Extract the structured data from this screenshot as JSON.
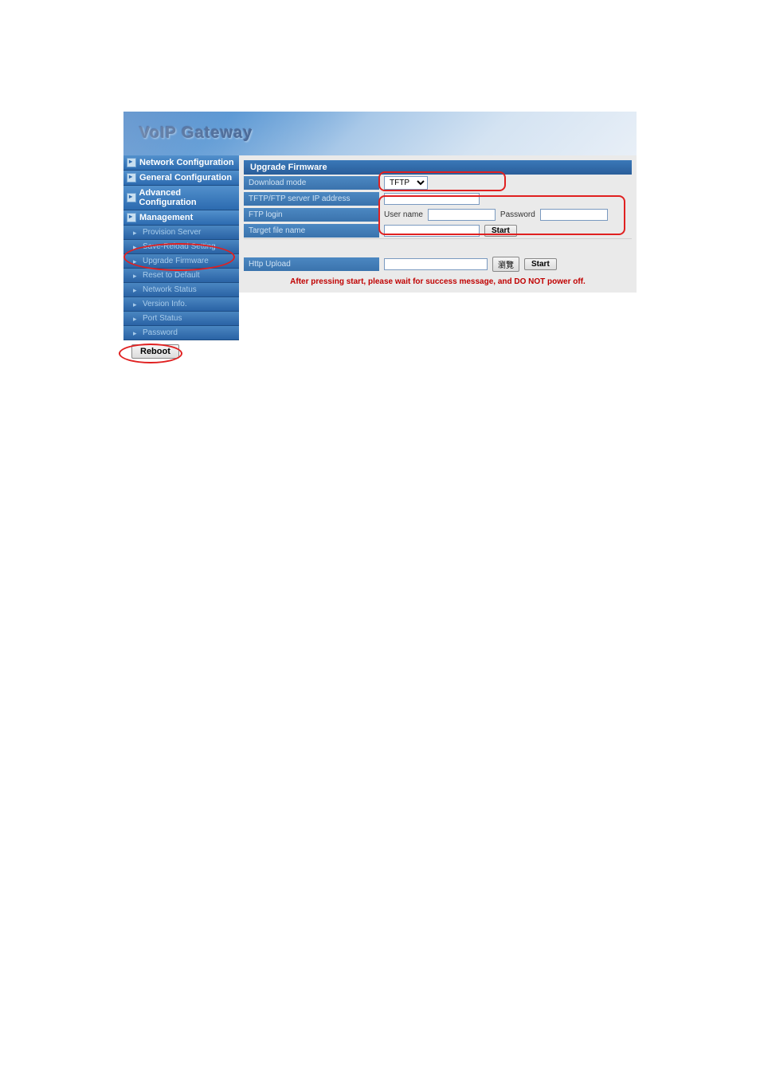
{
  "banner": {
    "title": "VoIP  Gateway"
  },
  "sidebar": {
    "top": [
      "Network Configuration",
      "General Configuration",
      "Advanced Configuration",
      "Management"
    ],
    "sub": [
      "Provision Server",
      "Save-Reload Setting",
      "Upgrade Firmware",
      "Reset to Default",
      "Network Status",
      "Version Info.",
      "Port Status",
      "Password"
    ],
    "reboot_label": "Reboot"
  },
  "main": {
    "section1": {
      "header": "Upgrade Firmware",
      "rows": {
        "download_mode_label": "Download mode",
        "download_mode_value": "TFTP",
        "server_ip_label": "TFTP/FTP server IP address",
        "ftp_login_label": "FTP login",
        "username_label": "User name",
        "password_label": "Password",
        "target_file_label": "Target file name",
        "start_label": "Start"
      }
    },
    "section2": {
      "header": "Http Upload",
      "browse_label": "瀏覽",
      "start_label": "Start"
    },
    "warning_text": "After pressing start, please wait for success message, and DO NOT power off."
  }
}
